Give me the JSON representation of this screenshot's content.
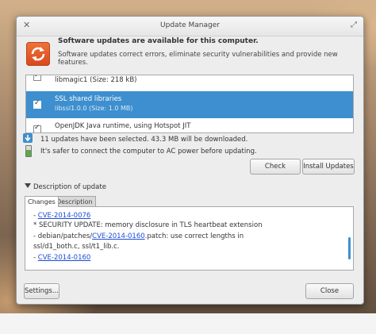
{
  "window": {
    "title": "Update Manager"
  },
  "header": {
    "title": "Software updates are available for this computer.",
    "subtitle": "Software updates correct errors, eliminate security vulnerabilities and provide new features."
  },
  "updates": [
    {
      "name": "libmagic1 (Size: 218 kB)",
      "checked": true,
      "selected": false
    },
    {
      "name": "SSL shared libraries",
      "size": "libssl1.0.0 (Size: 1.0 MB)",
      "checked": true,
      "selected": true
    },
    {
      "name": "OpenJDK Java runtime, using Hotspot JIT",
      "checked": true,
      "selected": false
    }
  ],
  "info": {
    "download": "11 updates have been selected. 43.3 MB will be downloaded.",
    "power": "It's safer to connect the computer to AC power before updating."
  },
  "buttons": {
    "check": "Check",
    "install": "Install Updates",
    "settings": "Settings...",
    "close": "Close"
  },
  "description": {
    "toggle_label": "Description of update",
    "tabs": [
      "Changes",
      "Description"
    ]
  },
  "changes": {
    "line1_prefix": "- ",
    "line1_link": "CVE-2014-0076",
    "line2": "* SECURITY UPDATE: memory disclosure in TLS heartbeat extension",
    "line3_prefix": "- debian/patches/",
    "line3_link": "CVE-2014-0160",
    "line3_suffix": ".patch: use correct lengths in",
    "line4": "ssl/d1_both.c, ssl/t1_lib.c.",
    "line5_prefix": "- ",
    "line5_link": "CVE-2014-0160"
  },
  "colors": {
    "selection": "#3d8fcf",
    "icon": "#e8582a",
    "link": "#1c4bd6"
  },
  "icons": {
    "app": "refresh-icon",
    "download": "download-icon",
    "power": "battery-icon"
  }
}
